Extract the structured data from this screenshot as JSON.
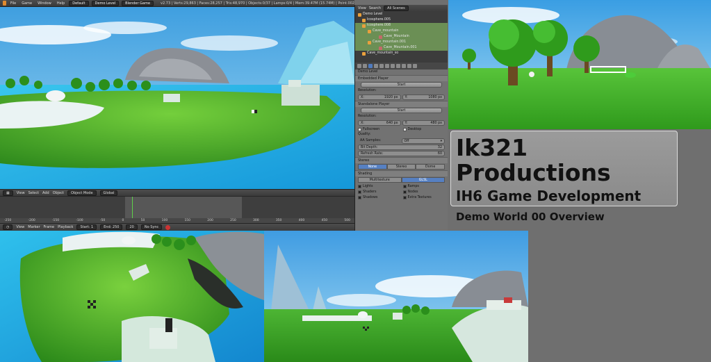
{
  "header": {
    "menus": [
      "File",
      "Game",
      "Window",
      "Help"
    ],
    "layout": "Default",
    "scene": "Demo Level",
    "engine": "Blender Game",
    "stats": "v2.73 | Verts:29,863 | Faces:28,257 | Tris:48,970 | Objects:0/37 | Lamps:0/4 | Mem:39.47M (15.74M) | Point.002"
  },
  "timeline_header": {
    "menus": [
      "View",
      "Select",
      "Add",
      "Object"
    ],
    "mode": "Object Mode",
    "orientation": "Global"
  },
  "timeline": {
    "ruler": [
      "-250",
      "-200",
      "-150",
      "-100",
      "-50",
      "0",
      "50",
      "100",
      "150",
      "200",
      "250",
      "300",
      "350",
      "400",
      "450",
      "500"
    ],
    "footer_menus": [
      "View",
      "Marker",
      "Frame",
      "Playback"
    ],
    "start": "Start: 1",
    "end": "End: 250",
    "current": "20",
    "sync": "No Sync"
  },
  "outliner": {
    "menus": [
      "View",
      "Search"
    ],
    "filter": "All Scenes",
    "rows": [
      {
        "label": "Demo Level",
        "kind": "scene",
        "selected": false
      },
      {
        "label": "Icosphere.005",
        "kind": "mesh",
        "selected": false
      },
      {
        "label": "Icosphere.008",
        "kind": "mesh",
        "selected": true
      },
      {
        "label": "Cave_mountain",
        "kind": "mesh",
        "selected": true
      },
      {
        "label": "Cave_Mountain",
        "kind": "mat",
        "selected": true
      },
      {
        "label": "Cave_mountain.001",
        "kind": "mesh",
        "selected": true
      },
      {
        "label": "Cave_Mountain.001",
        "kind": "mat",
        "selected": true
      },
      {
        "label": "Cave_mountain_so",
        "kind": "mesh",
        "selected": false
      }
    ]
  },
  "properties": {
    "crumb": "Demo Level",
    "embedded_section": "Embedded Player",
    "start_label": "Start",
    "resolution_label": "Resolution:",
    "embedded_res": {
      "x": "X:",
      "x_val": "1920 px",
      "y": "Y:",
      "y_val": "1080 px"
    },
    "standalone_section": "Standalone Player",
    "standalone_res": {
      "x": "X:",
      "x_val": "640 px",
      "y": "Y:",
      "y_val": "480 px"
    },
    "fullscreen": "Fullscreen",
    "desktop": "Desktop",
    "quality": "Quality:",
    "aa_label": "AA Samples:",
    "aa_value": "Off",
    "bit_depth": "Bit Depth:",
    "bit_depth_val": "32",
    "refresh": "Refresh Rate:",
    "refresh_val": "60",
    "stereo_section": "Stereo",
    "stereo_options": [
      "None",
      "Stereo",
      "Dome"
    ],
    "shading_section": "Shading",
    "shading_options": [
      "Multitexture",
      "GLSL"
    ],
    "checks_left": [
      "Lights",
      "Shaders",
      "Shadows"
    ],
    "checks_right": [
      "Ramps",
      "Nodes",
      "Extra Textures"
    ]
  },
  "title_card": {
    "line1": "Ik321 Productions",
    "line2": "IH6 Game Development",
    "line3": "Demo World 00 Overview"
  },
  "colors": {
    "sky": "#4aa6e0",
    "grass": "#3fae2a",
    "water": "#1fb7e6",
    "selection": "#6b8f55",
    "accent": "#5680c2"
  }
}
